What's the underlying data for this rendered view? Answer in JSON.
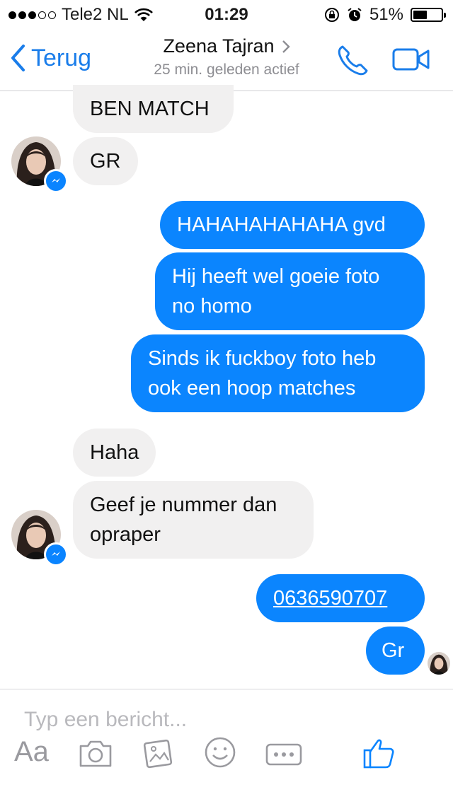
{
  "status": {
    "carrier": "Tele2 NL",
    "time": "01:29",
    "battery": "51%",
    "battery_level": 0.51
  },
  "nav": {
    "back_label": "Terug",
    "contact_name": "Zeena Tajran",
    "activity": "25 min. geleden actief"
  },
  "messages": [
    {
      "dir": "in",
      "text": "BEN MATCH"
    },
    {
      "dir": "in",
      "text": "GR"
    },
    {
      "dir": "out",
      "text": "HAHAHAHAHAHA gvd"
    },
    {
      "dir": "out",
      "line1": "Hij heeft wel goeie foto",
      "line2": "no homo"
    },
    {
      "dir": "out",
      "line1": "Sinds ik fuckboy foto heb",
      "line2": "ook een hoop matches"
    },
    {
      "dir": "in",
      "text": "Haha"
    },
    {
      "dir": "in",
      "line1": "Geef je nummer dan",
      "line2": "opraper"
    },
    {
      "dir": "out",
      "text": "0636590707"
    },
    {
      "dir": "out",
      "text": "Gr"
    }
  ],
  "composer": {
    "placeholder": "Typ een bericht...",
    "aa_label": "Aa"
  },
  "icons": [
    "back-chevron-icon",
    "phone-icon",
    "video-icon",
    "messenger-badge-icon",
    "camera-icon",
    "photo-icon",
    "smiley-icon",
    "more-icon",
    "thumbs-up-icon",
    "wifi-icon",
    "orientation-lock-icon",
    "alarm-icon"
  ],
  "colors": {
    "accent": "#0a84ff",
    "incoming_bubble": "#f1f0f0"
  }
}
